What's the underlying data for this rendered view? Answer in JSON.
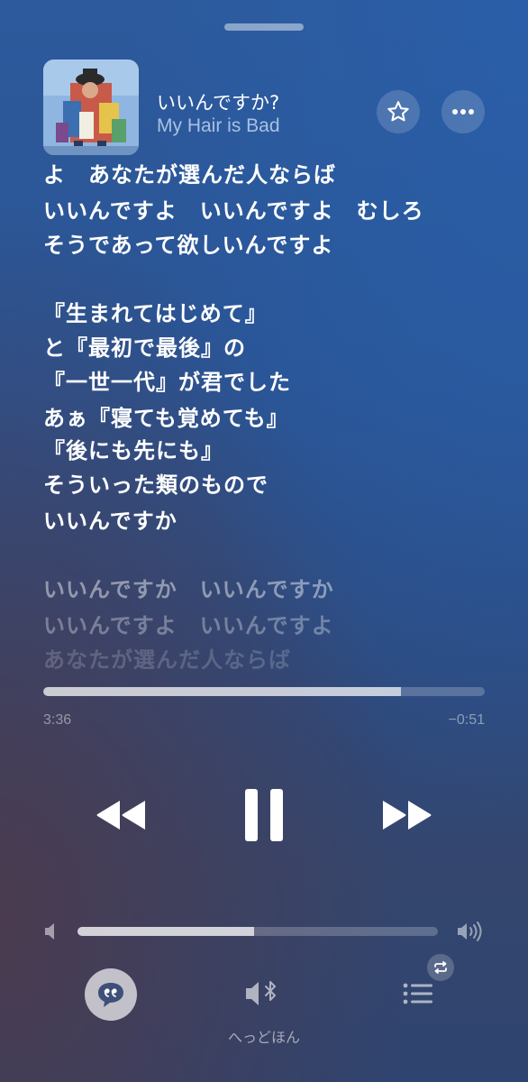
{
  "now_playing": {
    "title": "いいんですか?",
    "artist": "My Hair is Bad"
  },
  "lyrics": {
    "lines": [
      "よ　あなたが選んだ人ならば",
      "いいんですよ　いいんですよ　むしろ",
      "そうであって欲しいんですよ",
      "『生まれてはじめて』",
      "と『最初で最後』の",
      "『一世一代』が君でした",
      "あぁ『寝ても覚めても』",
      "『後にも先にも』",
      "そういった類のもので",
      "いいんですか",
      "いいんですか　いいんですか",
      "いいんですよ　いいんですよ",
      "あなたが選んだ人ならば"
    ]
  },
  "playback": {
    "elapsed": "3:36",
    "remaining": "−0:51",
    "progress_fraction": 0.811
  },
  "volume": {
    "level_fraction": 0.49
  },
  "airplay": {
    "device_label": "へっどほん"
  },
  "icons": {
    "favorite": "star-icon",
    "more": "ellipsis-icon",
    "rewind": "backward-icon",
    "pause": "pause-icon",
    "forward": "forward-icon",
    "volume_low": "speaker-low-icon",
    "volume_high": "speaker-high-icon",
    "lyrics": "quote-bubble-icon",
    "output": "speaker-bluetooth-icon",
    "queue": "list-icon",
    "repeat": "repeat-icon"
  },
  "colors": {
    "background_top": "#2d5a9c",
    "background_bottom": "#34466e",
    "primary_text": "#ffffff",
    "artist_text": "#bed4f0"
  }
}
